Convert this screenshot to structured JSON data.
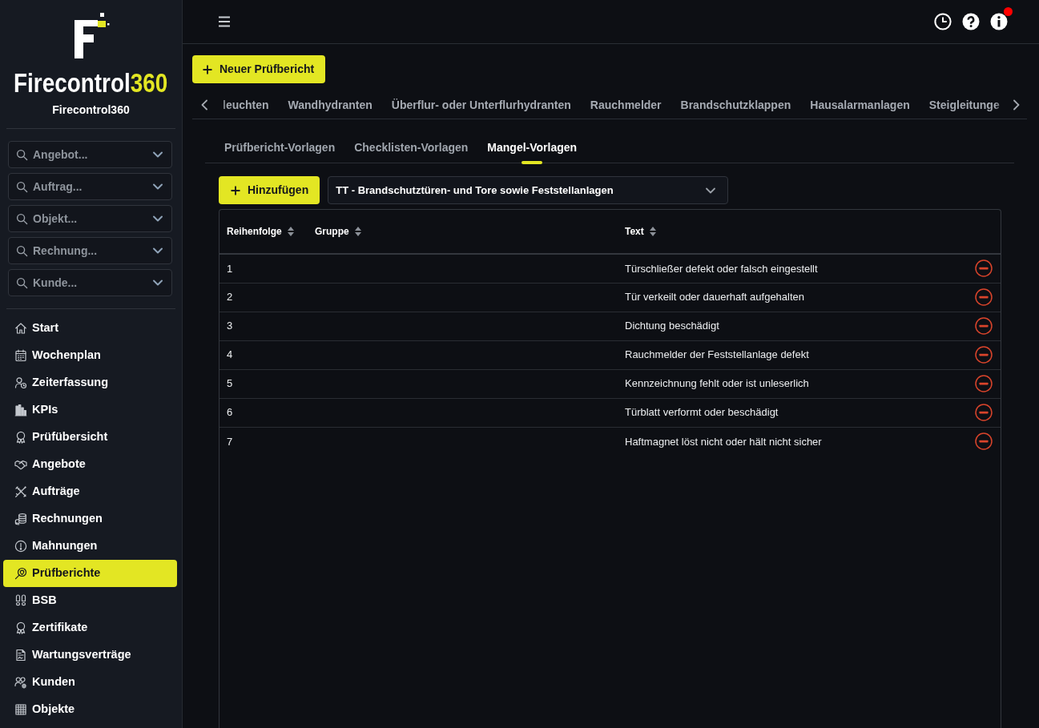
{
  "sidebar": {
    "brand": {
      "name": "Firecontrol",
      "suffix": "360"
    },
    "subtitle": "Firecontrol360",
    "searches": [
      {
        "placeholder": "Angebot..."
      },
      {
        "placeholder": "Auftrag..."
      },
      {
        "placeholder": "Objekt..."
      },
      {
        "placeholder": "Rechnung..."
      },
      {
        "placeholder": "Kunde..."
      }
    ],
    "items": [
      {
        "label": "Start",
        "selected": false
      },
      {
        "label": "Wochenplan",
        "selected": false
      },
      {
        "label": "Zeiterfassung",
        "selected": false
      },
      {
        "label": "KPIs",
        "selected": false
      },
      {
        "label": "Prüfübersicht",
        "selected": false
      },
      {
        "label": "Angebote",
        "selected": false
      },
      {
        "label": "Aufträge",
        "selected": false
      },
      {
        "label": "Rechnungen",
        "selected": false
      },
      {
        "label": "Mahnungen",
        "selected": false
      },
      {
        "label": "Prüfberichte",
        "selected": true
      },
      {
        "label": "BSB",
        "selected": false
      },
      {
        "label": "Zertifikate",
        "selected": false
      },
      {
        "label": "Wartungsverträge",
        "selected": false
      },
      {
        "label": "Kunden",
        "selected": false
      },
      {
        "label": "Objekte",
        "selected": false
      }
    ]
  },
  "header": {
    "notification": true
  },
  "new_button": "Neuer Prüfbericht",
  "category_tabs": [
    {
      "label": "leuchten",
      "selected": false
    },
    {
      "label": "Wandhydranten",
      "selected": false
    },
    {
      "label": "Überflur- oder Unterflurhydranten",
      "selected": false
    },
    {
      "label": "Rauchmelder",
      "selected": false
    },
    {
      "label": "Brandschutzklappen",
      "selected": false
    },
    {
      "label": "Hausalarmanlagen",
      "selected": false
    },
    {
      "label": "Steigleitunge",
      "selected": false
    }
  ],
  "template_tabs": [
    {
      "label": "Prüfbericht-Vorlagen",
      "selected": false
    },
    {
      "label": "Checklisten-Vorlagen",
      "selected": false
    },
    {
      "label": "Mangel-Vorlagen",
      "selected": true
    }
  ],
  "add_button": "Hinzufügen",
  "category_select": {
    "value": "TT - Brandschutztüren- und Tore sowie Feststellanlagen"
  },
  "table": {
    "columns": [
      {
        "label": "Reihenfolge",
        "sortable": true
      },
      {
        "label": "Gruppe",
        "sortable": true
      },
      {
        "label": "Text",
        "sortable": true
      }
    ],
    "rows": [
      {
        "order": "1",
        "text": "Türschließer defekt oder falsch eingestellt"
      },
      {
        "order": "2",
        "text": "Tür verkeilt oder dauerhaft aufgehalten"
      },
      {
        "order": "3",
        "text": "Dichtung beschädigt"
      },
      {
        "order": "4",
        "text": "Rauchmelder der Feststellanlage defekt"
      },
      {
        "order": "5",
        "text": "Kennzeichnung fehlt oder ist unleserlich"
      },
      {
        "order": "6",
        "text": "Türblatt verformt oder beschädigt"
      },
      {
        "order": "7",
        "text": "Haftmagnet löst nicht oder hält nicht sicher"
      }
    ]
  }
}
